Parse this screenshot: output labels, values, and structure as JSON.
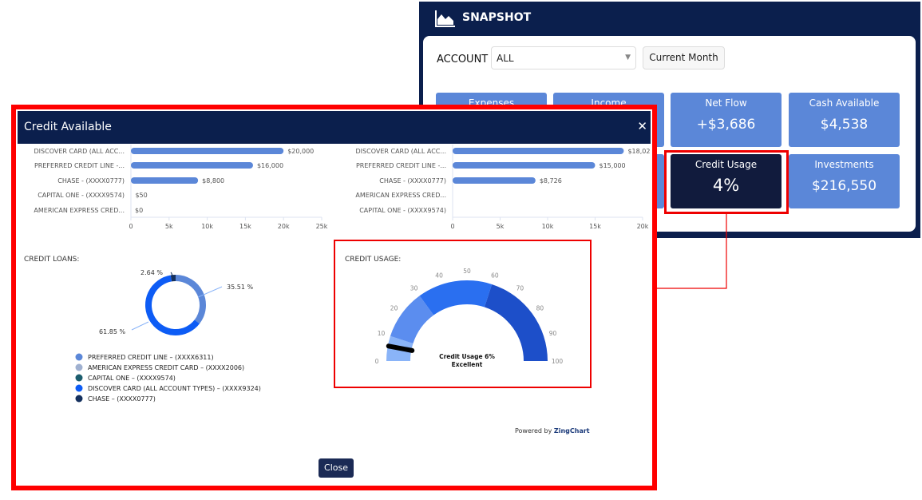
{
  "snapshot": {
    "title": "SNAPSHOT",
    "icon": "area-chart-icon",
    "account_label": "ACCOUNT",
    "account_value": "ALL",
    "period_button": "Current Month",
    "tiles": [
      {
        "title": "Expenses",
        "value": ""
      },
      {
        "title": "Income",
        "value": ""
      },
      {
        "title": "Net Flow",
        "value": "+$3,686"
      },
      {
        "title": "Cash Available",
        "value": "$4,538"
      },
      {
        "title": "Credit Usage",
        "value": "4%"
      },
      {
        "title": "Investments",
        "value": "$216,550"
      }
    ]
  },
  "modal": {
    "title": "Credit Available",
    "close_icon": "close-icon",
    "close_button": "Close",
    "powered_prefix": "Powered by",
    "powered_brand": "ZingChart"
  },
  "chart_data": [
    {
      "type": "bar",
      "orientation": "horizontal",
      "categories": [
        "DISCOVER CARD (ALL ACC...",
        "PREFERRED CREDIT LINE -...",
        "CHASE - (XXXX0777)",
        "CAPITAL ONE - (XXXX9574)",
        "AMERICAN EXPRESS CRED..."
      ],
      "values": [
        20000,
        16000,
        8800,
        50,
        0
      ],
      "value_labels": [
        "$20,000",
        "$16,000",
        "$8,800",
        "$50",
        "$0"
      ],
      "xlim": [
        0,
        25000
      ],
      "ticks": [
        "0",
        "5k",
        "10k",
        "15k",
        "20k",
        "25k"
      ],
      "color": "#5b87d8"
    },
    {
      "type": "bar",
      "orientation": "horizontal",
      "categories": [
        "DISCOVER CARD (ALL ACC...",
        "PREFERRED CREDIT LINE -...",
        "CHASE - (XXXX0777)",
        "AMERICAN EXPRESS CRED...",
        "CAPITAL ONE - (XXXX9574)"
      ],
      "values": [
        18020,
        15000,
        8726,
        0,
        0
      ],
      "value_labels": [
        "$18,02",
        "$15,000",
        "$8,726",
        "",
        ""
      ],
      "xlim": [
        0,
        20000
      ],
      "ticks": [
        "0",
        "5k",
        "10k",
        "15k",
        "20k"
      ],
      "color": "#5b87d8"
    },
    {
      "type": "pie",
      "donut": true,
      "title": "CREDIT LOANS:",
      "slices": [
        {
          "name": "CHASE – (XXXX0777)",
          "value": 2.64,
          "label": "2.64 %",
          "color": "#14305e"
        },
        {
          "name": "PREFERRED CREDIT LINE – (XXXX6311)",
          "value": 35.51,
          "label": "35.51 %",
          "color": "#5b87d8"
        },
        {
          "name": "DISCOVER CARD (ALL ACCOUNT TYPES) – (XXXX9324)",
          "value": 61.85,
          "label": "61.85 %",
          "color": "#0d5cf5"
        }
      ],
      "legend": [
        {
          "name": "PREFERRED CREDIT LINE – (XXXX6311)",
          "color": "#5b87d8"
        },
        {
          "name": "AMERICAN EXPRESS CREDIT CARD – (XXXX2006)",
          "color": "#9fb0d0"
        },
        {
          "name": "CAPITAL ONE – (XXXX9574)",
          "color": "#1c5d6e"
        },
        {
          "name": "DISCOVER CARD (ALL ACCOUNT TYPES) – (XXXX9324)",
          "color": "#0d5cf5"
        },
        {
          "name": "CHASE – (XXXX0777)",
          "color": "#14305e"
        }
      ]
    },
    {
      "type": "gauge",
      "title": "CREDIT USAGE:",
      "value": 6,
      "range": [
        0,
        100
      ],
      "ticks": [
        "0",
        "10",
        "20",
        "30",
        "40",
        "50",
        "60",
        "70",
        "80",
        "90",
        "100"
      ],
      "bands": [
        {
          "from": 0,
          "to": 10,
          "color": "#8ab4f8"
        },
        {
          "from": 10,
          "to": 30,
          "color": "#5b8def"
        },
        {
          "from": 30,
          "to": 60,
          "color": "#2a6ff0"
        },
        {
          "from": 60,
          "to": 100,
          "color": "#1d4fc9"
        }
      ],
      "center_label": "Credit Usage 6%",
      "center_sublabel": "Excellent"
    }
  ]
}
